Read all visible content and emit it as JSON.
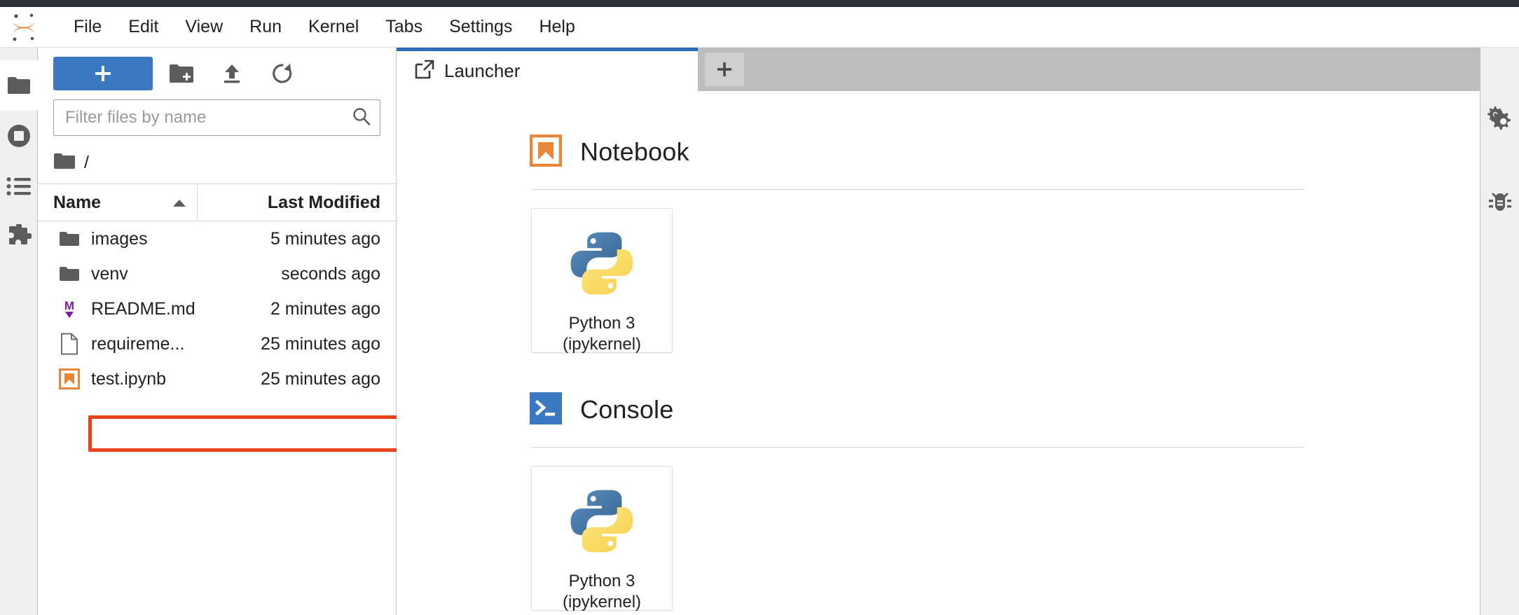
{
  "app": {
    "logo_icon": "jupyter-logo-icon",
    "accent_blue": "#3b78c3",
    "tab_accent": "#2b6cb8",
    "annotation_color": "#e8411c",
    "notebook_orange": "#e8873a",
    "console_blue": "#3b78c3",
    "markdown_purple": "#7b1fa2"
  },
  "menubar": {
    "items": [
      {
        "label": "File"
      },
      {
        "label": "Edit"
      },
      {
        "label": "View"
      },
      {
        "label": "Run"
      },
      {
        "label": "Kernel"
      },
      {
        "label": "Tabs"
      },
      {
        "label": "Settings"
      },
      {
        "label": "Help"
      }
    ]
  },
  "left_rail": {
    "items": [
      {
        "icon": "folder-icon",
        "name": "file-browser",
        "active": true
      },
      {
        "icon": "running-stop-icon",
        "name": "running-terminals-kernels",
        "active": false
      },
      {
        "icon": "list-icon",
        "name": "table-of-contents",
        "active": false
      },
      {
        "icon": "puzzle-icon",
        "name": "extension-manager",
        "active": false
      }
    ]
  },
  "right_rail": {
    "items": [
      {
        "icon": "gears-icon",
        "name": "property-inspector"
      },
      {
        "icon": "bug-icon",
        "name": "debugger"
      }
    ]
  },
  "filebrowser": {
    "toolbar": {
      "new_launcher_label": "+",
      "new_folder_icon": "new-folder-icon",
      "upload_icon": "upload-icon",
      "refresh_icon": "refresh-icon"
    },
    "filter": {
      "placeholder": "Filter files by name",
      "value": "",
      "search_icon": "search-icon"
    },
    "breadcrumb": {
      "root_icon": "folder-icon",
      "path": "/"
    },
    "columns": {
      "name": "Name",
      "last_modified": "Last Modified",
      "sort_indicator": "sort-ascending-icon"
    },
    "rows": [
      {
        "icon": "folder-icon",
        "name": "images",
        "modified": "5 minutes ago",
        "highlighted": false
      },
      {
        "icon": "folder-icon",
        "name": "venv",
        "modified": "seconds ago",
        "highlighted": false
      },
      {
        "icon": "markdown-icon",
        "name": "README.md",
        "modified": "2 minutes ago",
        "highlighted": false
      },
      {
        "icon": "file-icon",
        "name": "requireme...",
        "modified": "25 minutes ago",
        "highlighted": false
      },
      {
        "icon": "notebook-icon",
        "name": "test.ipynb",
        "modified": "25 minutes ago",
        "highlighted": true
      }
    ]
  },
  "dock": {
    "tabs": [
      {
        "label": "Launcher",
        "icon": "launcher-icon",
        "current": true
      }
    ],
    "add_tab_label": "+"
  },
  "launcher": {
    "sections": [
      {
        "title": "Notebook",
        "icon": "notebook-icon",
        "cards": [
          {
            "icon": "python-logo-icon",
            "line1": "Python 3",
            "line2": "(ipykernel)"
          }
        ]
      },
      {
        "title": "Console",
        "icon": "console-icon",
        "cards": [
          {
            "icon": "python-logo-icon",
            "line1": "Python 3",
            "line2": "(ipykernel)"
          }
        ]
      }
    ]
  }
}
